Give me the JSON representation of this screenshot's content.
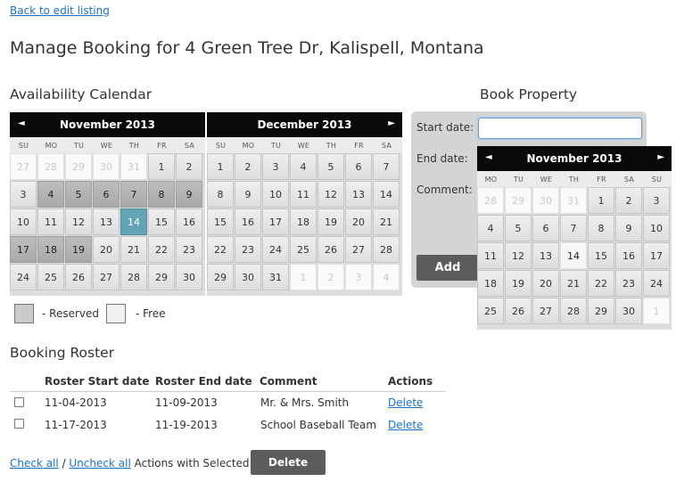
{
  "nav": {
    "back_link": "Back to edit listing"
  },
  "page": {
    "title": "Manage Booking for 4 Green Tree Dr, Kalispell, Montana"
  },
  "availability": {
    "heading": "Availability Calendar",
    "prev_icon": "◄",
    "next_icon": "►",
    "legend": {
      "reserved": "- Reserved",
      "free": "- Free"
    },
    "colors": {
      "reserved": "#b3b3b3",
      "free": "#e8e8e8",
      "today": "#63a4b5",
      "header": "#0a0a0a"
    }
  },
  "weekdays": [
    "SU",
    "MO",
    "TU",
    "WE",
    "TH",
    "FR",
    "SA"
  ],
  "calendars": {
    "availability_left": {
      "title": "November 2013",
      "weeks": [
        [
          {
            "d": "27",
            "s": "other"
          },
          {
            "d": "28",
            "s": "other"
          },
          {
            "d": "29",
            "s": "other"
          },
          {
            "d": "30",
            "s": "other"
          },
          {
            "d": "31",
            "s": "other"
          },
          {
            "d": "1",
            "s": ""
          },
          {
            "d": "2",
            "s": ""
          }
        ],
        [
          {
            "d": "3",
            "s": ""
          },
          {
            "d": "4",
            "s": "reserved"
          },
          {
            "d": "5",
            "s": "reserved"
          },
          {
            "d": "6",
            "s": "reserved"
          },
          {
            "d": "7",
            "s": "reserved"
          },
          {
            "d": "8",
            "s": "reserved"
          },
          {
            "d": "9",
            "s": "reserved"
          }
        ],
        [
          {
            "d": "10",
            "s": ""
          },
          {
            "d": "11",
            "s": ""
          },
          {
            "d": "12",
            "s": ""
          },
          {
            "d": "13",
            "s": ""
          },
          {
            "d": "14",
            "s": "today"
          },
          {
            "d": "15",
            "s": ""
          },
          {
            "d": "16",
            "s": ""
          }
        ],
        [
          {
            "d": "17",
            "s": "reserved"
          },
          {
            "d": "18",
            "s": "reserved"
          },
          {
            "d": "19",
            "s": "reserved"
          },
          {
            "d": "20",
            "s": ""
          },
          {
            "d": "21",
            "s": ""
          },
          {
            "d": "22",
            "s": ""
          },
          {
            "d": "23",
            "s": ""
          }
        ],
        [
          {
            "d": "24",
            "s": ""
          },
          {
            "d": "25",
            "s": ""
          },
          {
            "d": "26",
            "s": ""
          },
          {
            "d": "27",
            "s": ""
          },
          {
            "d": "28",
            "s": ""
          },
          {
            "d": "29",
            "s": ""
          },
          {
            "d": "30",
            "s": ""
          }
        ]
      ]
    },
    "availability_right": {
      "title": "December 2013",
      "weeks": [
        [
          {
            "d": "1",
            "s": ""
          },
          {
            "d": "2",
            "s": ""
          },
          {
            "d": "3",
            "s": ""
          },
          {
            "d": "4",
            "s": ""
          },
          {
            "d": "5",
            "s": ""
          },
          {
            "d": "6",
            "s": ""
          },
          {
            "d": "7",
            "s": ""
          }
        ],
        [
          {
            "d": "8",
            "s": ""
          },
          {
            "d": "9",
            "s": ""
          },
          {
            "d": "10",
            "s": ""
          },
          {
            "d": "11",
            "s": ""
          },
          {
            "d": "12",
            "s": ""
          },
          {
            "d": "13",
            "s": ""
          },
          {
            "d": "14",
            "s": ""
          }
        ],
        [
          {
            "d": "15",
            "s": ""
          },
          {
            "d": "16",
            "s": ""
          },
          {
            "d": "17",
            "s": ""
          },
          {
            "d": "18",
            "s": ""
          },
          {
            "d": "19",
            "s": ""
          },
          {
            "d": "20",
            "s": ""
          },
          {
            "d": "21",
            "s": ""
          }
        ],
        [
          {
            "d": "22",
            "s": ""
          },
          {
            "d": "23",
            "s": ""
          },
          {
            "d": "24",
            "s": ""
          },
          {
            "d": "25",
            "s": ""
          },
          {
            "d": "26",
            "s": ""
          },
          {
            "d": "27",
            "s": ""
          },
          {
            "d": "28",
            "s": ""
          }
        ],
        [
          {
            "d": "29",
            "s": ""
          },
          {
            "d": "30",
            "s": ""
          },
          {
            "d": "31",
            "s": ""
          },
          {
            "d": "1",
            "s": "other"
          },
          {
            "d": "2",
            "s": "other"
          },
          {
            "d": "3",
            "s": "other"
          },
          {
            "d": "4",
            "s": "other"
          }
        ]
      ]
    },
    "picker": {
      "title": "November 2013",
      "weekdays": [
        "MO",
        "TU",
        "WE",
        "TH",
        "FR",
        "SA",
        "SU"
      ],
      "weeks": [
        [
          {
            "d": "28",
            "s": "other"
          },
          {
            "d": "29",
            "s": "other"
          },
          {
            "d": "30",
            "s": "other"
          },
          {
            "d": "31",
            "s": "other"
          },
          {
            "d": "1",
            "s": ""
          },
          {
            "d": "2",
            "s": ""
          },
          {
            "d": "3",
            "s": ""
          }
        ],
        [
          {
            "d": "4",
            "s": ""
          },
          {
            "d": "5",
            "s": ""
          },
          {
            "d": "6",
            "s": ""
          },
          {
            "d": "7",
            "s": ""
          },
          {
            "d": "8",
            "s": ""
          },
          {
            "d": "9",
            "s": ""
          },
          {
            "d": "10",
            "s": ""
          }
        ],
        [
          {
            "d": "11",
            "s": ""
          },
          {
            "d": "12",
            "s": ""
          },
          {
            "d": "13",
            "s": ""
          },
          {
            "d": "14",
            "s": "hl"
          },
          {
            "d": "15",
            "s": ""
          },
          {
            "d": "16",
            "s": ""
          },
          {
            "d": "17",
            "s": ""
          }
        ],
        [
          {
            "d": "18",
            "s": ""
          },
          {
            "d": "19",
            "s": ""
          },
          {
            "d": "20",
            "s": ""
          },
          {
            "d": "21",
            "s": ""
          },
          {
            "d": "22",
            "s": ""
          },
          {
            "d": "23",
            "s": ""
          },
          {
            "d": "24",
            "s": ""
          }
        ],
        [
          {
            "d": "25",
            "s": ""
          },
          {
            "d": "26",
            "s": ""
          },
          {
            "d": "27",
            "s": ""
          },
          {
            "d": "28",
            "s": ""
          },
          {
            "d": "29",
            "s": ""
          },
          {
            "d": "30",
            "s": ""
          },
          {
            "d": "1",
            "s": "other"
          }
        ]
      ]
    }
  },
  "book": {
    "heading": "Book Property",
    "start_label": "Start date:",
    "start_value": "",
    "end_label": "End date:",
    "comment_label": "Comment:",
    "add_button": "Add"
  },
  "roster": {
    "heading": "Booking Roster",
    "columns": [
      "Roster Start date",
      "Roster End date",
      "Comment",
      "Actions"
    ],
    "rows": [
      {
        "start": "11-04-2013",
        "end": "11-09-2013",
        "comment": "Mr. & Mrs. Smith",
        "action": "Delete"
      },
      {
        "start": "11-17-2013",
        "end": "11-19-2013",
        "comment": "School Baseball Team",
        "action": "Delete"
      }
    ]
  },
  "footer": {
    "check_all": "Check all",
    "separator": " / ",
    "uncheck_all": "Uncheck all",
    "actions_label": " Actions with Selected:",
    "delete_button": "Delete"
  }
}
